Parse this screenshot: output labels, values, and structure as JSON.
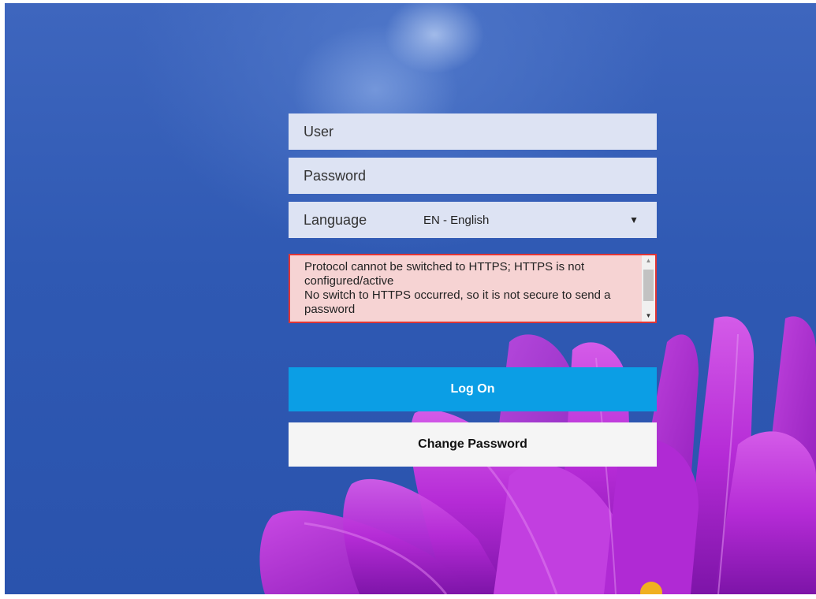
{
  "login": {
    "user_placeholder": "User",
    "password_placeholder": "Password",
    "language_label": "Language",
    "language_value": "EN - English",
    "language_caret": "▼"
  },
  "message": {
    "text": "Protocol cannot be switched to HTTPS; HTTPS is not configured/active\nNo switch to HTTPS occurred, so it is not secure to send a password",
    "scroll_up": "▲",
    "scroll_down": "▼"
  },
  "buttons": {
    "logon_label": "Log On",
    "change_password_label": "Change Password"
  },
  "colors": {
    "background_blue": "#3e66be",
    "field_bg": "#dde3f3",
    "error_border": "#e03535",
    "error_bg": "#f6d3d3",
    "logon_bg": "#0b9ee5",
    "flower_magenta": "#b62ad6"
  }
}
